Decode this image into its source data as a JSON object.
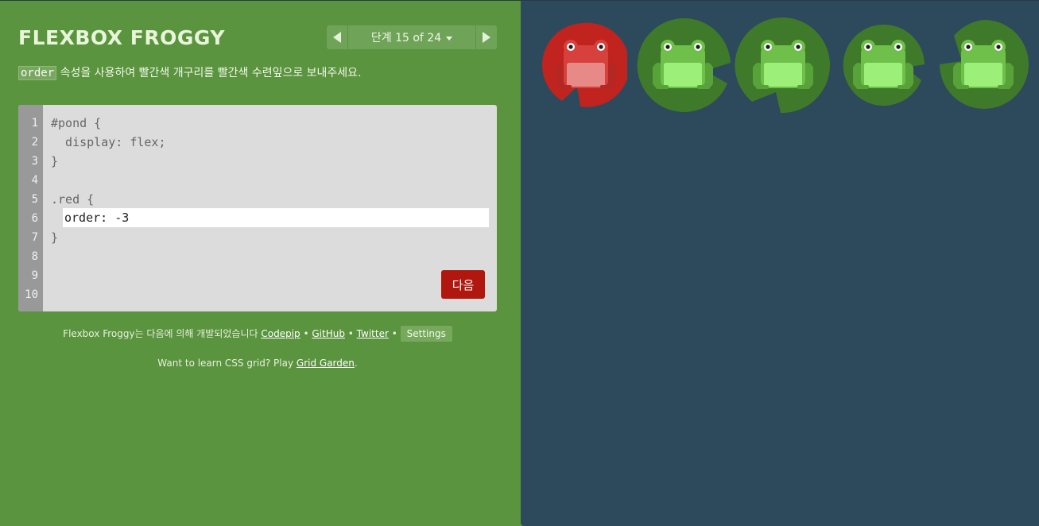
{
  "app": {
    "title": "FLEXBOX FROGGY"
  },
  "level_nav": {
    "indicator": "단계 15 of 24"
  },
  "instructions": {
    "code_word": "order",
    "text": " 속성을 사용하여 빨간색 개구리를 빨간색 수련잎으로 보내주세요."
  },
  "editor": {
    "line_numbers": [
      "1",
      "2",
      "3",
      "4",
      "5",
      "6",
      "7",
      "8",
      "9",
      "10"
    ],
    "lines": {
      "l1": "#pond {",
      "l2": "  display: flex;",
      "l3": "}",
      "l5": ".red {",
      "l7": "}"
    },
    "input_value": "order: -3",
    "next_label": "다음"
  },
  "credits": {
    "prefix": "Flexbox Froggy는 다음에 의해 개발되었습니다 ",
    "codepip": "Codepip",
    "github": "GitHub",
    "twitter": "Twitter",
    "separator": " • ",
    "settings": "Settings"
  },
  "promo": {
    "text": "Want to learn CSS grid? Play ",
    "link": "Grid Garden",
    "suffix": "."
  },
  "colors": {
    "sidebar_bg": "#5a943f",
    "pond_bg": "#2c4a5b",
    "red_pad": "#c1231f",
    "green_pad": "#3f7a2a",
    "green_frog": "#6ec04b",
    "red_frog": "#d7413d",
    "next_button": "#b0180f"
  },
  "pond": {
    "frogs": [
      "red",
      "green",
      "green",
      "green",
      "green"
    ],
    "lilypads": [
      "red",
      "green",
      "green",
      "green",
      "green"
    ]
  }
}
